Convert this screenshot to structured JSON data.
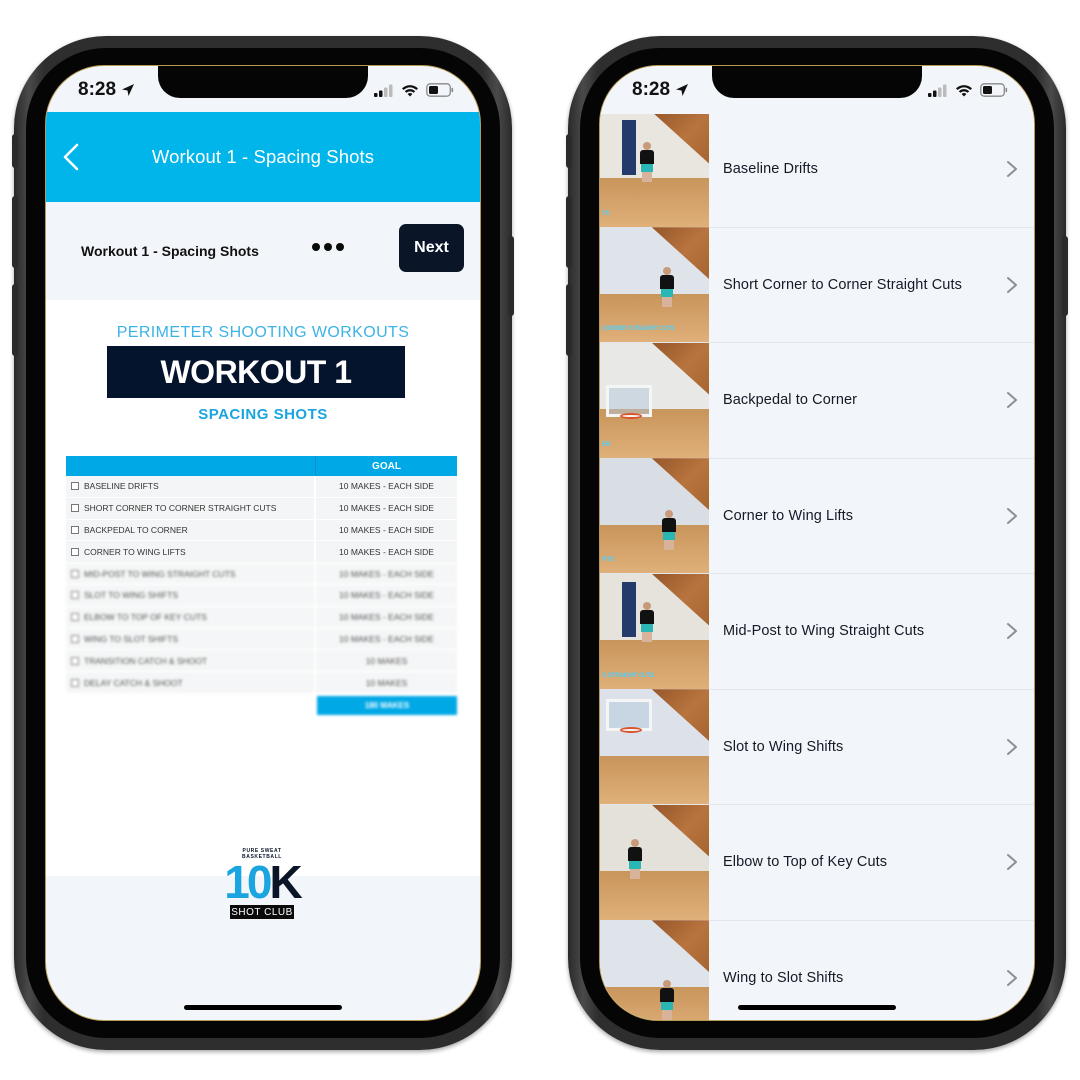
{
  "status_bar": {
    "time": "8:28",
    "location_icon": "location-arrow-icon",
    "signal_icon": "cellular-signal-icon",
    "wifi_icon": "wifi-icon",
    "battery_icon": "battery-icon"
  },
  "left_screen": {
    "nav": {
      "back_icon": "chevron-left-icon",
      "title": "Workout 1 - Spacing Shots"
    },
    "sub_bar": {
      "title": "Workout 1 - Spacing Shots",
      "more_icon": "more-horizontal-icon",
      "next_label": "Next"
    },
    "document": {
      "kicker": "PERIMETER SHOOTING WORKOUTS",
      "banner": "WORKOUT 1",
      "subtitle": "SPACING SHOTS",
      "table": {
        "goal_header": "GOAL",
        "rows": [
          {
            "drill": "BASELINE DRIFTS",
            "goal": "10 MAKES - EACH SIDE"
          },
          {
            "drill": "SHORT CORNER TO CORNER STRAIGHT CUTS",
            "goal": "10 MAKES - EACH SIDE"
          },
          {
            "drill": "BACKPEDAL TO CORNER",
            "goal": "10 MAKES - EACH SIDE"
          },
          {
            "drill": "CORNER TO WING LIFTS",
            "goal": "10 MAKES - EACH SIDE"
          },
          {
            "drill": "MID-POST TO WING STRAIGHT CUTS",
            "goal": "10 MAKES - EACH SIDE"
          },
          {
            "drill": "SLOT TO WING SHIFTS",
            "goal": "10 MAKES - EACH SIDE"
          },
          {
            "drill": "ELBOW TO TOP OF KEY CUTS",
            "goal": "10 MAKES - EACH SIDE"
          },
          {
            "drill": "WING TO SLOT SHIFTS",
            "goal": "10 MAKES - EACH SIDE"
          },
          {
            "drill": "TRANSITION CATCH & SHOOT",
            "goal": "10 MAKES"
          },
          {
            "drill": "DELAY CATCH & SHOOT",
            "goal": "10 MAKES"
          }
        ],
        "total": "180 MAKES"
      },
      "logo": {
        "tagline": "PURE SWEAT BASKETBALL",
        "mark_left": "10",
        "mark_right": "K",
        "club": "SHOT CLUB"
      }
    }
  },
  "right_screen": {
    "drills": [
      {
        "label": "Baseline Drifts",
        "caption": "TS"
      },
      {
        "label": "Short Corner to Corner Straight Cuts",
        "caption": "CORNER STRAIGHT CUTS"
      },
      {
        "label": "Backpedal to Corner",
        "caption": "ER"
      },
      {
        "label": "Corner to Wing Lifts",
        "caption": "IFTS"
      },
      {
        "label": "Mid-Post to Wing Straight Cuts",
        "caption": "G STRAIGHT CUTS"
      },
      {
        "label": "Slot to Wing Shifts",
        "caption": ""
      },
      {
        "label": "Elbow to Top of Key Cuts",
        "caption": ""
      },
      {
        "label": "Wing to Slot Shifts",
        "caption": ""
      }
    ],
    "chevron_icon": "chevron-right-icon"
  },
  "colors": {
    "accent": "#00b5e9",
    "navy": "#0b1528",
    "screen_bg": "#f2f5f9",
    "table_blue": "#00a8e6"
  }
}
